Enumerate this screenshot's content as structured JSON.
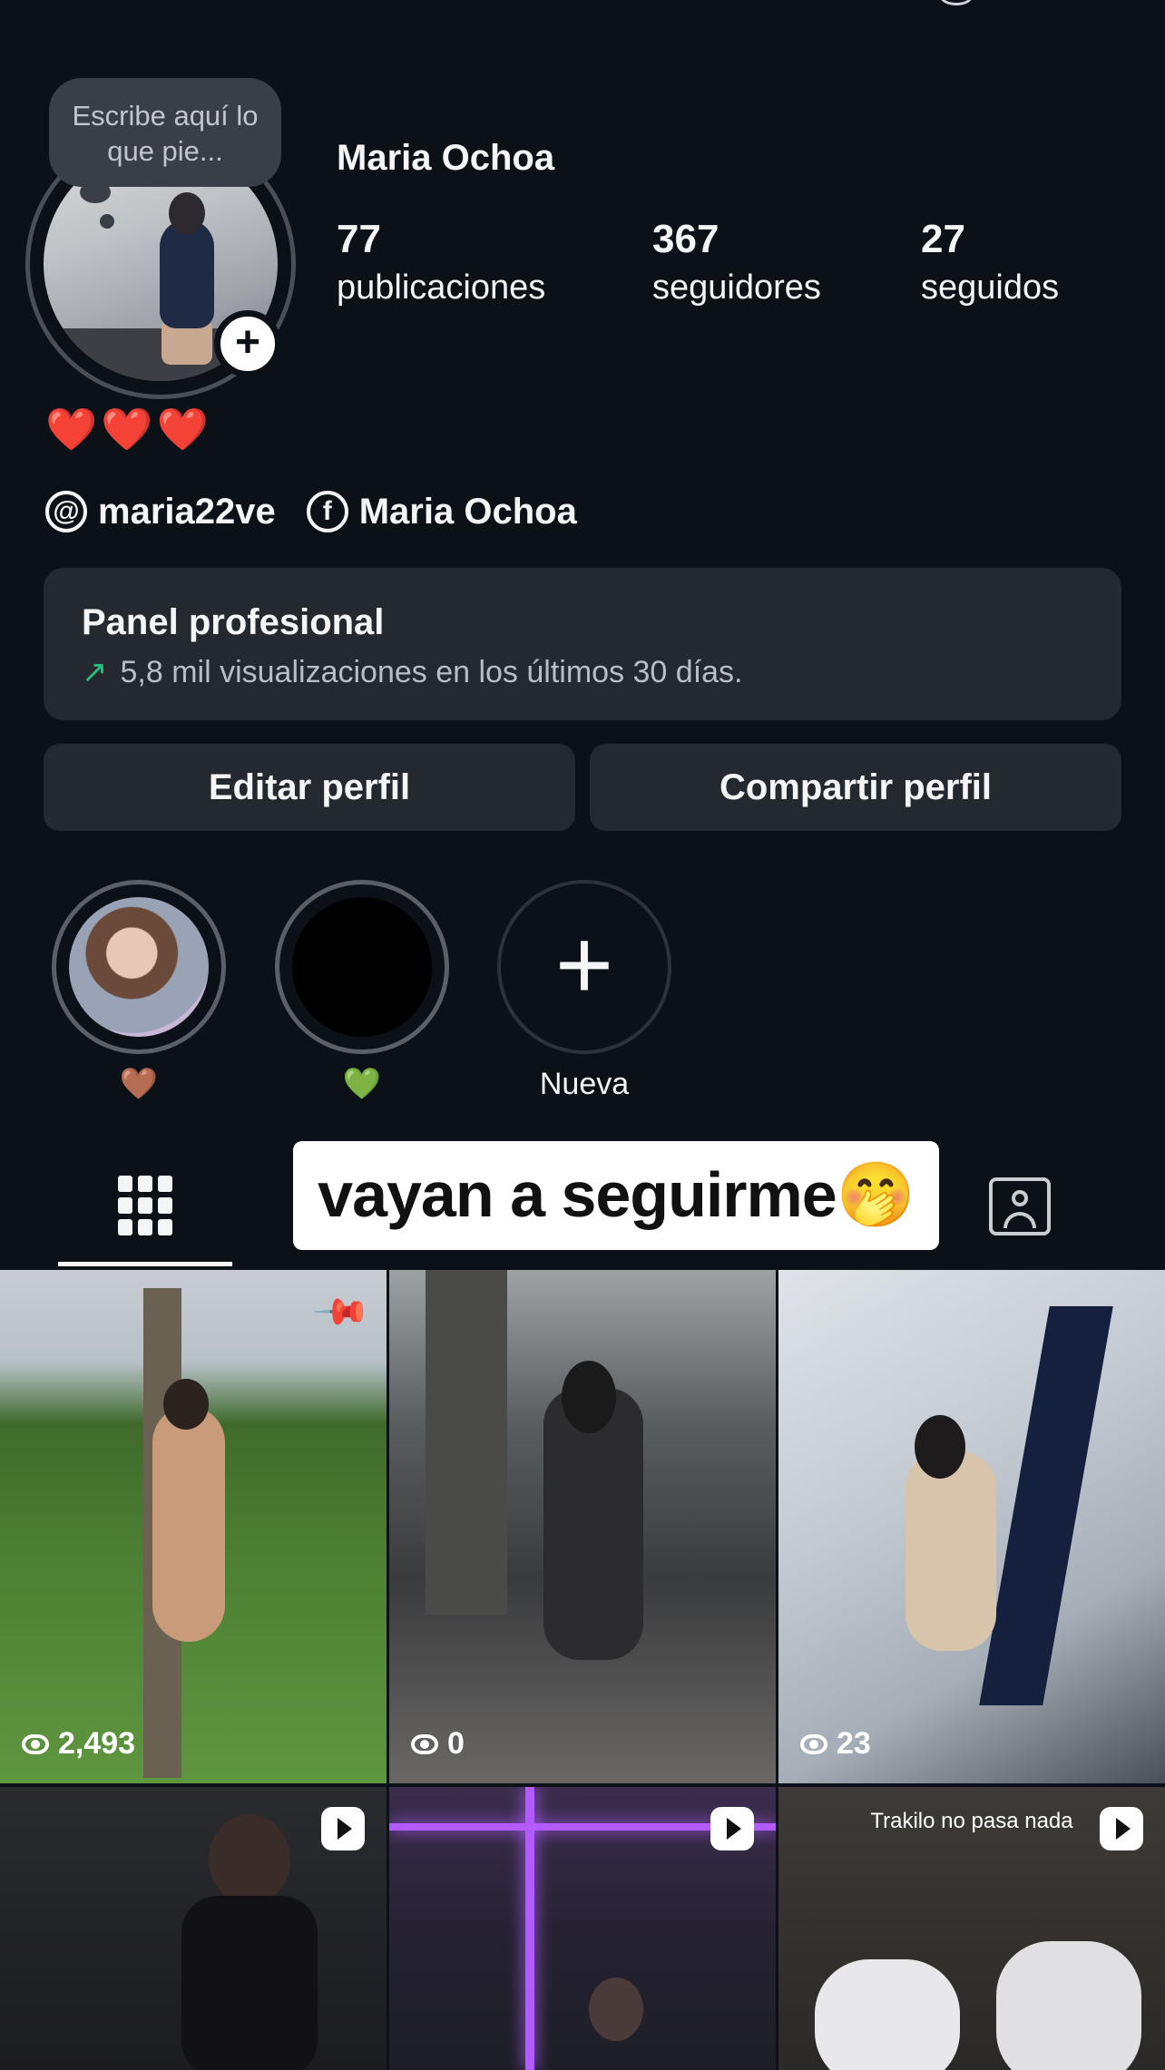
{
  "profile": {
    "name": "Maria Ochoa",
    "note": "Escribe aquí lo que pie...",
    "add_story_symbol": "+",
    "hearts": "❤️❤️❤️",
    "stats": [
      {
        "value": "77",
        "label": "publicaciones"
      },
      {
        "value": "367",
        "label": "seguidores"
      },
      {
        "value": "27",
        "label": "seguidos"
      }
    ],
    "links": [
      {
        "icon": "threads-icon",
        "text": "maria22ve"
      },
      {
        "icon": "facebook-icon",
        "text": "Maria Ochoa"
      }
    ]
  },
  "pro_panel": {
    "title": "Panel profesional",
    "subtitle": "5,8 mil visualizaciones en los últimos 30 días.",
    "arrow": "↗"
  },
  "buttons": {
    "edit": "Editar perfil",
    "share": "Compartir perfil"
  },
  "highlights": [
    {
      "label": "🤎"
    },
    {
      "label": "💚"
    },
    {
      "label": "Nueva",
      "symbol": "+"
    }
  ],
  "tabs": {
    "grid_icon": "grid-icon",
    "tagged_icon": "tagged-icon"
  },
  "caption_banner": "vayan a seguirme🤭",
  "posts": [
    {
      "views": "2,493",
      "pinned": true
    },
    {
      "views": "0"
    },
    {
      "views": "23"
    },
    {
      "reel": true
    },
    {
      "reel": true
    },
    {
      "reel": true,
      "caption": "Trakilo no pasa nada"
    }
  ],
  "colors": {
    "background": "#0c1118",
    "panel": "#24282f",
    "accent_green": "#27c07a"
  }
}
